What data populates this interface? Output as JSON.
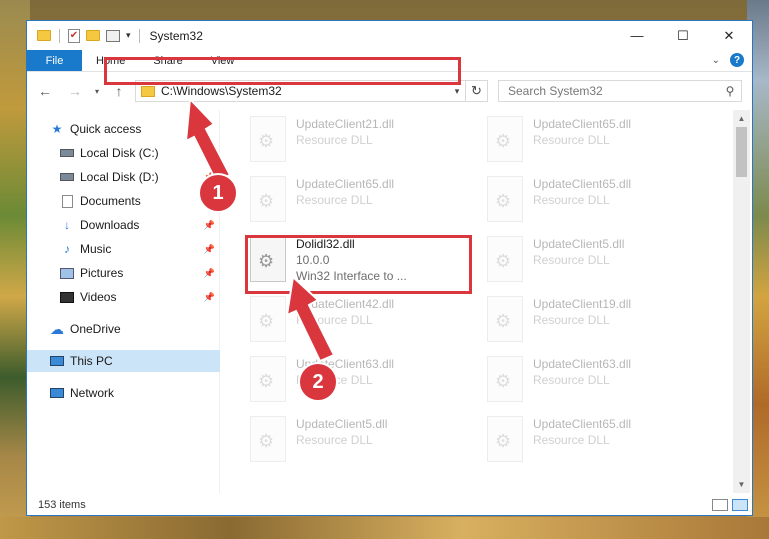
{
  "window": {
    "title": "System32",
    "controls": {
      "minimize": "—",
      "maximize": "☐",
      "close": "✕"
    }
  },
  "ribbon": {
    "file_tab": "File",
    "tabs": [
      "Home",
      "Share",
      "View"
    ],
    "help": "?"
  },
  "address": {
    "path": "C:\\Windows\\System32",
    "search_placeholder": "Search System32"
  },
  "sidebar": {
    "items": [
      {
        "label": "Quick access",
        "icon": "star-icon",
        "pinned": false
      },
      {
        "label": "Local Disk (C:)",
        "icon": "drive-icon",
        "pinned": true
      },
      {
        "label": "Local Disk (D:)",
        "icon": "drive-icon",
        "pinned": true
      },
      {
        "label": "Documents",
        "icon": "documents-icon",
        "pinned": true
      },
      {
        "label": "Downloads",
        "icon": "downloads-icon",
        "pinned": true
      },
      {
        "label": "Music",
        "icon": "music-icon",
        "pinned": true
      },
      {
        "label": "Pictures",
        "icon": "pictures-icon",
        "pinned": true
      },
      {
        "label": "Videos",
        "icon": "videos-icon",
        "pinned": true
      },
      {
        "label": "OneDrive",
        "icon": "onedrive-icon",
        "pinned": false
      },
      {
        "label": "This PC",
        "icon": "pc-icon",
        "pinned": false,
        "selected": true
      },
      {
        "label": "Network",
        "icon": "network-icon",
        "pinned": false
      }
    ]
  },
  "files": [
    {
      "name": "UpdateClient21.dll",
      "sub": "Resource DLL",
      "faded": true
    },
    {
      "name": "UpdateClient65.dll",
      "sub": "Resource DLL",
      "faded": true
    },
    {
      "name": "UpdateClient65.dll",
      "sub": "Resource DLL",
      "faded": true
    },
    {
      "name": "UpdateClient65.dll",
      "sub": "Resource DLL",
      "faded": true
    },
    {
      "name": "Dolidl32.dll",
      "sub": "10.0.0",
      "sub2": "Win32 Interface to ...",
      "faded": false
    },
    {
      "name": "UpdateClient5.dll",
      "sub": "Resource DLL",
      "faded": true
    },
    {
      "name": "UpdateClient42.dll",
      "sub": "Resource DLL",
      "faded": true
    },
    {
      "name": "UpdateClient19.dll",
      "sub": "Resource DLL",
      "faded": true
    },
    {
      "name": "UpdateClient63.dll",
      "sub": "Resource DLL",
      "faded": true
    },
    {
      "name": "UpdateClient63.dll",
      "sub": "Resource DLL",
      "faded": true
    },
    {
      "name": "UpdateClient5.dll",
      "sub": "Resource DLL",
      "faded": true
    },
    {
      "name": "UpdateClient65.dll",
      "sub": "Resource DLL",
      "faded": true
    }
  ],
  "status": {
    "count": "153 items"
  },
  "annotations": {
    "badge1": "1",
    "badge2": "2",
    "color": "#d9363e"
  }
}
